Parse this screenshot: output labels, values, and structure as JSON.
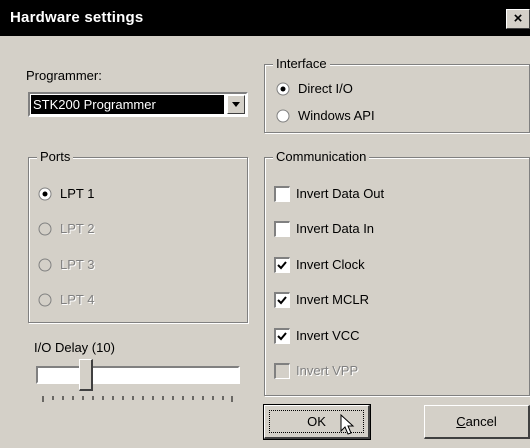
{
  "window": {
    "title": "Hardware settings",
    "close_label": "×"
  },
  "programmer": {
    "label": "Programmer:",
    "selected": "STK200 Programmer"
  },
  "ports": {
    "legend": "Ports",
    "options": [
      {
        "label": "LPT 1",
        "checked": true,
        "enabled": true
      },
      {
        "label": "LPT 2",
        "checked": false,
        "enabled": false
      },
      {
        "label": "LPT 3",
        "checked": false,
        "enabled": false
      },
      {
        "label": "LPT 4",
        "checked": false,
        "enabled": false
      }
    ]
  },
  "io_delay": {
    "label": "I/O Delay (10)",
    "value": 10
  },
  "interface": {
    "legend": "Interface",
    "options": [
      {
        "label": "Direct I/O",
        "checked": true
      },
      {
        "label": "Windows API",
        "checked": false
      }
    ]
  },
  "communication": {
    "legend": "Communication",
    "options": [
      {
        "label": "Invert Data Out",
        "checked": false,
        "enabled": true
      },
      {
        "label": "Invert Data In",
        "checked": false,
        "enabled": true
      },
      {
        "label": "Invert Clock",
        "checked": true,
        "enabled": true
      },
      {
        "label": "Invert MCLR",
        "checked": true,
        "enabled": true
      },
      {
        "label": "Invert VCC",
        "checked": true,
        "enabled": true
      },
      {
        "label": "Invert VPP",
        "checked": false,
        "enabled": false
      }
    ]
  },
  "buttons": {
    "ok": "OK",
    "cancel_first": "C",
    "cancel_rest": "ancel"
  },
  "colors": {
    "face": "#d4d0c8",
    "shadow": "#808080",
    "highlight": "#ffffff",
    "title_bar": "#000000"
  }
}
